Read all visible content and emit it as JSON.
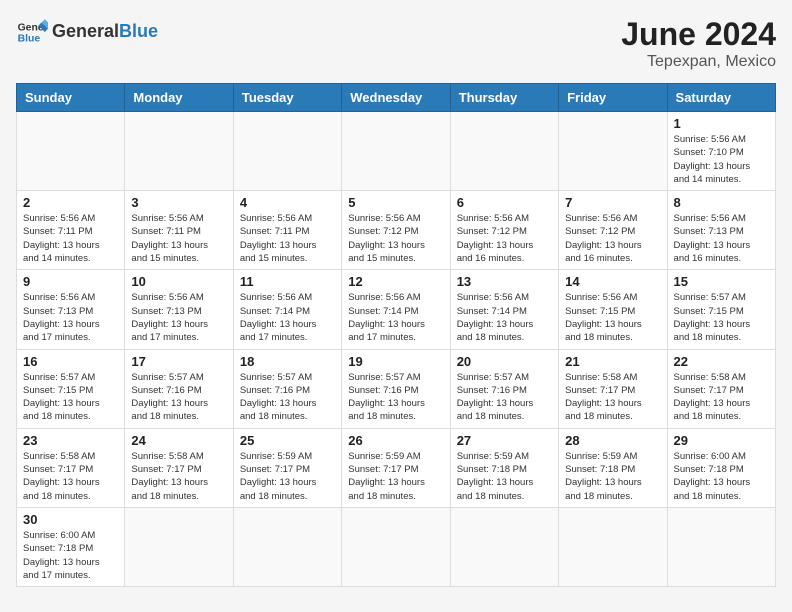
{
  "header": {
    "logo_general": "General",
    "logo_blue": "Blue",
    "month_year": "June 2024",
    "location": "Tepexpan, Mexico"
  },
  "weekdays": [
    "Sunday",
    "Monday",
    "Tuesday",
    "Wednesday",
    "Thursday",
    "Friday",
    "Saturday"
  ],
  "days": [
    {
      "date": "",
      "info": ""
    },
    {
      "date": "",
      "info": ""
    },
    {
      "date": "",
      "info": ""
    },
    {
      "date": "",
      "info": ""
    },
    {
      "date": "",
      "info": ""
    },
    {
      "date": "",
      "info": ""
    },
    {
      "date": "1",
      "info": "Sunrise: 5:56 AM\nSunset: 7:10 PM\nDaylight: 13 hours\nand 14 minutes."
    },
    {
      "date": "2",
      "info": "Sunrise: 5:56 AM\nSunset: 7:11 PM\nDaylight: 13 hours\nand 14 minutes."
    },
    {
      "date": "3",
      "info": "Sunrise: 5:56 AM\nSunset: 7:11 PM\nDaylight: 13 hours\nand 15 minutes."
    },
    {
      "date": "4",
      "info": "Sunrise: 5:56 AM\nSunset: 7:11 PM\nDaylight: 13 hours\nand 15 minutes."
    },
    {
      "date": "5",
      "info": "Sunrise: 5:56 AM\nSunset: 7:12 PM\nDaylight: 13 hours\nand 15 minutes."
    },
    {
      "date": "6",
      "info": "Sunrise: 5:56 AM\nSunset: 7:12 PM\nDaylight: 13 hours\nand 16 minutes."
    },
    {
      "date": "7",
      "info": "Sunrise: 5:56 AM\nSunset: 7:12 PM\nDaylight: 13 hours\nand 16 minutes."
    },
    {
      "date": "8",
      "info": "Sunrise: 5:56 AM\nSunset: 7:13 PM\nDaylight: 13 hours\nand 16 minutes."
    },
    {
      "date": "9",
      "info": "Sunrise: 5:56 AM\nSunset: 7:13 PM\nDaylight: 13 hours\nand 17 minutes."
    },
    {
      "date": "10",
      "info": "Sunrise: 5:56 AM\nSunset: 7:13 PM\nDaylight: 13 hours\nand 17 minutes."
    },
    {
      "date": "11",
      "info": "Sunrise: 5:56 AM\nSunset: 7:14 PM\nDaylight: 13 hours\nand 17 minutes."
    },
    {
      "date": "12",
      "info": "Sunrise: 5:56 AM\nSunset: 7:14 PM\nDaylight: 13 hours\nand 17 minutes."
    },
    {
      "date": "13",
      "info": "Sunrise: 5:56 AM\nSunset: 7:14 PM\nDaylight: 13 hours\nand 18 minutes."
    },
    {
      "date": "14",
      "info": "Sunrise: 5:56 AM\nSunset: 7:15 PM\nDaylight: 13 hours\nand 18 minutes."
    },
    {
      "date": "15",
      "info": "Sunrise: 5:57 AM\nSunset: 7:15 PM\nDaylight: 13 hours\nand 18 minutes."
    },
    {
      "date": "16",
      "info": "Sunrise: 5:57 AM\nSunset: 7:15 PM\nDaylight: 13 hours\nand 18 minutes."
    },
    {
      "date": "17",
      "info": "Sunrise: 5:57 AM\nSunset: 7:16 PM\nDaylight: 13 hours\nand 18 minutes."
    },
    {
      "date": "18",
      "info": "Sunrise: 5:57 AM\nSunset: 7:16 PM\nDaylight: 13 hours\nand 18 minutes."
    },
    {
      "date": "19",
      "info": "Sunrise: 5:57 AM\nSunset: 7:16 PM\nDaylight: 13 hours\nand 18 minutes."
    },
    {
      "date": "20",
      "info": "Sunrise: 5:57 AM\nSunset: 7:16 PM\nDaylight: 13 hours\nand 18 minutes."
    },
    {
      "date": "21",
      "info": "Sunrise: 5:58 AM\nSunset: 7:17 PM\nDaylight: 13 hours\nand 18 minutes."
    },
    {
      "date": "22",
      "info": "Sunrise: 5:58 AM\nSunset: 7:17 PM\nDaylight: 13 hours\nand 18 minutes."
    },
    {
      "date": "23",
      "info": "Sunrise: 5:58 AM\nSunset: 7:17 PM\nDaylight: 13 hours\nand 18 minutes."
    },
    {
      "date": "24",
      "info": "Sunrise: 5:58 AM\nSunset: 7:17 PM\nDaylight: 13 hours\nand 18 minutes."
    },
    {
      "date": "25",
      "info": "Sunrise: 5:59 AM\nSunset: 7:17 PM\nDaylight: 13 hours\nand 18 minutes."
    },
    {
      "date": "26",
      "info": "Sunrise: 5:59 AM\nSunset: 7:17 PM\nDaylight: 13 hours\nand 18 minutes."
    },
    {
      "date": "27",
      "info": "Sunrise: 5:59 AM\nSunset: 7:18 PM\nDaylight: 13 hours\nand 18 minutes."
    },
    {
      "date": "28",
      "info": "Sunrise: 5:59 AM\nSunset: 7:18 PM\nDaylight: 13 hours\nand 18 minutes."
    },
    {
      "date": "29",
      "info": "Sunrise: 6:00 AM\nSunset: 7:18 PM\nDaylight: 13 hours\nand 18 minutes."
    },
    {
      "date": "30",
      "info": "Sunrise: 6:00 AM\nSunset: 7:18 PM\nDaylight: 13 hours\nand 17 minutes."
    }
  ]
}
